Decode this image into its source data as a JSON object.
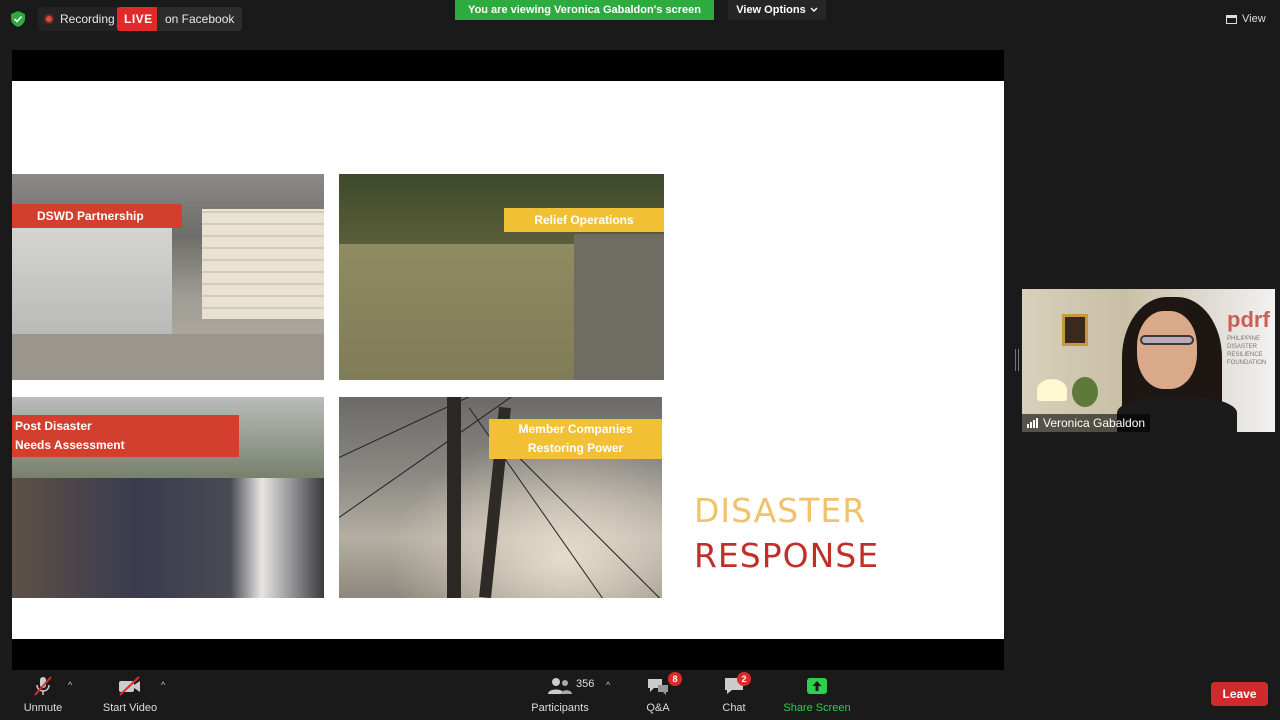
{
  "topbar": {
    "recording_label": "Recording",
    "live_label": "LIVE",
    "facebook_label": "on Facebook",
    "banner_text": "You are viewing Veronica Gabaldon's screen",
    "view_options_label": "View Options",
    "view_label": "View"
  },
  "slide": {
    "photos": [
      {
        "caption": "DSWD Partnership"
      },
      {
        "caption": "Relief Operations"
      },
      {
        "caption": "Post Disaster\nNeeds Assessment"
      },
      {
        "caption": "Member Companies\nRestoring Power"
      }
    ],
    "title_line1": "DISASTER",
    "title_line2": "RESPONSE",
    "colors": {
      "title1": "#f0c26a",
      "title2": "#c0302a",
      "tag_red": "#d33f2f",
      "tag_yellow": "#f2c035"
    }
  },
  "video": {
    "participant_name": "Veronica Gabaldon",
    "logo_text": "pdrf",
    "logo_sub": "PHILIPPINE DISASTER RESILIENCE FOUNDATION"
  },
  "toolbar": {
    "unmute_label": "Unmute",
    "start_video_label": "Start Video",
    "participants_label": "Participants",
    "participants_count": "356",
    "qa_label": "Q&A",
    "qa_badge": "8",
    "chat_label": "Chat",
    "chat_badge": "2",
    "share_label": "Share Screen",
    "leave_label": "Leave"
  }
}
